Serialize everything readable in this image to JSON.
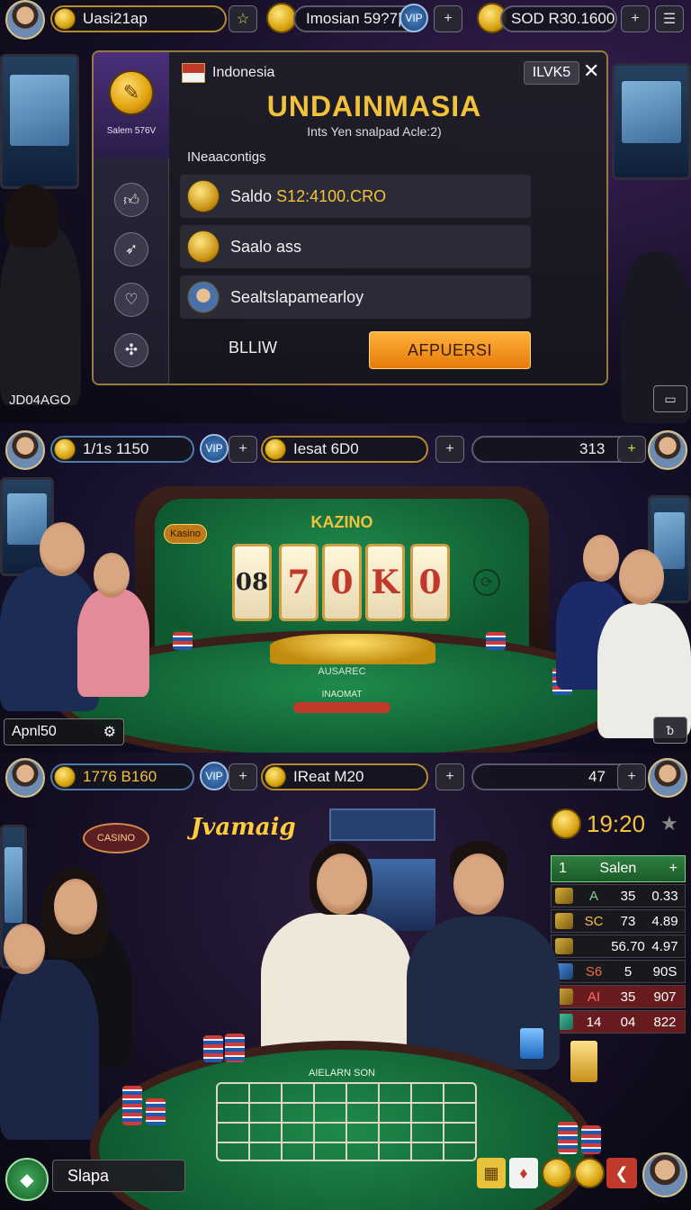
{
  "panel1": {
    "hud": {
      "left_label": "Uasi21ap",
      "center_label": "Imosian 59?7|",
      "right_label": "SOD R30.1600",
      "plus_symbol": "+",
      "star_symbol": "☆",
      "menu_symbol": "☰",
      "vip_text": "VIP"
    },
    "dialog": {
      "region": "Indonesia",
      "code_badge": "ILVK5",
      "close_symbol": "✕",
      "title": "UNDAINMASIA",
      "subtitle": "Ints Yen snalpad Acle:2)",
      "section_label": "INeaacontigs",
      "side_label": "Salem 576V",
      "rows": [
        {
          "prefix": "Saldo",
          "value": "S12:4100.CRO"
        },
        {
          "prefix": "Saalo ass",
          "value": ""
        },
        {
          "prefix": "Sealtslapamearloy",
          "value": ""
        }
      ],
      "cancel_label": "BLLIW",
      "confirm_label": "AFPUERSI"
    },
    "corner_label": "JD04AGO"
  },
  "panel2": {
    "hud": {
      "left_label": "1/1s 1150",
      "center_label": "Iesat 6D0",
      "right_value": "313",
      "plus_symbol": "+",
      "vip_text": "VIP"
    },
    "table_sign": "KAZINO",
    "table_badge": "Kasino",
    "reels": [
      "08",
      "7",
      "0",
      "K",
      "0"
    ],
    "felt_text": "INAOMAT",
    "felt_sub": "AUSAREC",
    "left_field": "Apnl50"
  },
  "panel3": {
    "hud": {
      "left_label": "1776 B160",
      "center_label": "IReat M20",
      "right_value": "47",
      "plus_symbol": "+",
      "vip_text": "VIP"
    },
    "neon_sign": "Jvamaig",
    "sign_left": "CASINO",
    "timer": "19:20",
    "felt_title": "AIELARN SON",
    "board": {
      "title_left": "1",
      "title": "Salen",
      "title_right": "+",
      "rows": [
        {
          "a": "A",
          "b": "35",
          "c": "0.33"
        },
        {
          "a": "SC",
          "b": "73",
          "c": "4.89"
        },
        {
          "a": "",
          "b": "56.70",
          "c": "4.97"
        },
        {
          "a": "S6",
          "b": "5",
          "c": "90S"
        },
        {
          "a": "AI",
          "b": "35",
          "c": "907"
        },
        {
          "a": "14",
          "b": "04",
          "c": "822"
        }
      ]
    },
    "bottom_field": "Slapa"
  },
  "colors": {
    "gold": "#d9a40f",
    "orange_button": "#f29a1f",
    "felt_green": "#1f8a4c",
    "board_green": "#2f7f3f"
  }
}
